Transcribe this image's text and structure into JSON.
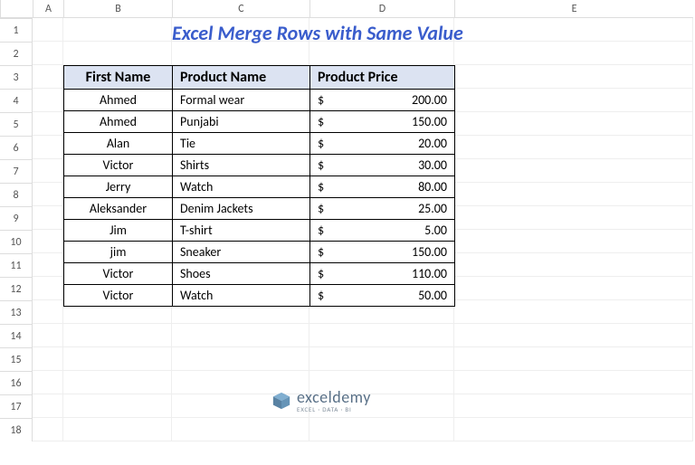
{
  "title": "Excel Merge Rows with Same Value",
  "columns": [
    "A",
    "B",
    "C",
    "D",
    "E"
  ],
  "rows": [
    "1",
    "2",
    "3",
    "4",
    "5",
    "6",
    "7",
    "8",
    "9",
    "10",
    "11",
    "12",
    "13",
    "14",
    "15",
    "16",
    "17",
    "18"
  ],
  "table": {
    "headers": {
      "first_name": "First Name",
      "product_name": "Product Name",
      "product_price": "Product Price"
    },
    "currency": "$",
    "data": [
      {
        "first_name": "Ahmed",
        "product_name": "Formal wear",
        "price": "200.00"
      },
      {
        "first_name": "Ahmed",
        "product_name": "Punjabi",
        "price": "150.00"
      },
      {
        "first_name": "Alan",
        "product_name": "Tie",
        "price": "20.00"
      },
      {
        "first_name": "Victor",
        "product_name": "Shirts",
        "price": "30.00"
      },
      {
        "first_name": "Jerry",
        "product_name": "Watch",
        "price": "80.00"
      },
      {
        "first_name": "Aleksander",
        "product_name": "Denim Jackets",
        "price": "25.00"
      },
      {
        "first_name": "Jim",
        "product_name": "T-shirt",
        "price": "5.00"
      },
      {
        "first_name": "jim",
        "product_name": "Sneaker",
        "price": "150.00"
      },
      {
        "first_name": "Victor",
        "product_name": "Shoes",
        "price": "110.00"
      },
      {
        "first_name": "Victor",
        "product_name": "Watch",
        "price": "50.00"
      }
    ]
  },
  "logo": {
    "main": "exceldemy",
    "sub": "EXCEL · DATA · BI"
  }
}
